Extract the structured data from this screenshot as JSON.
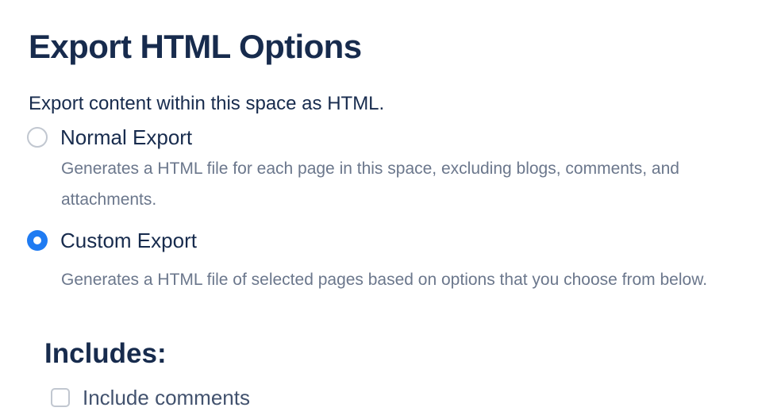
{
  "page": {
    "title": "Export HTML Options",
    "intro": "Export content within this space as HTML."
  },
  "export_options": [
    {
      "label": "Normal Export",
      "description": "Generates a HTML file for each page in this space, excluding blogs, comments, and attachments.",
      "selected": false
    },
    {
      "label": "Custom Export",
      "description": "Generates a HTML file of selected pages based on options that you choose from below.",
      "selected": true
    }
  ],
  "includes": {
    "heading": "Includes:",
    "items": [
      {
        "label": "Include comments",
        "checked": false
      }
    ]
  },
  "colors": {
    "heading": "#172b4d",
    "description": "#6b778c",
    "radio_selected": "#1f7bf2",
    "control_border": "#c1c7d0"
  }
}
